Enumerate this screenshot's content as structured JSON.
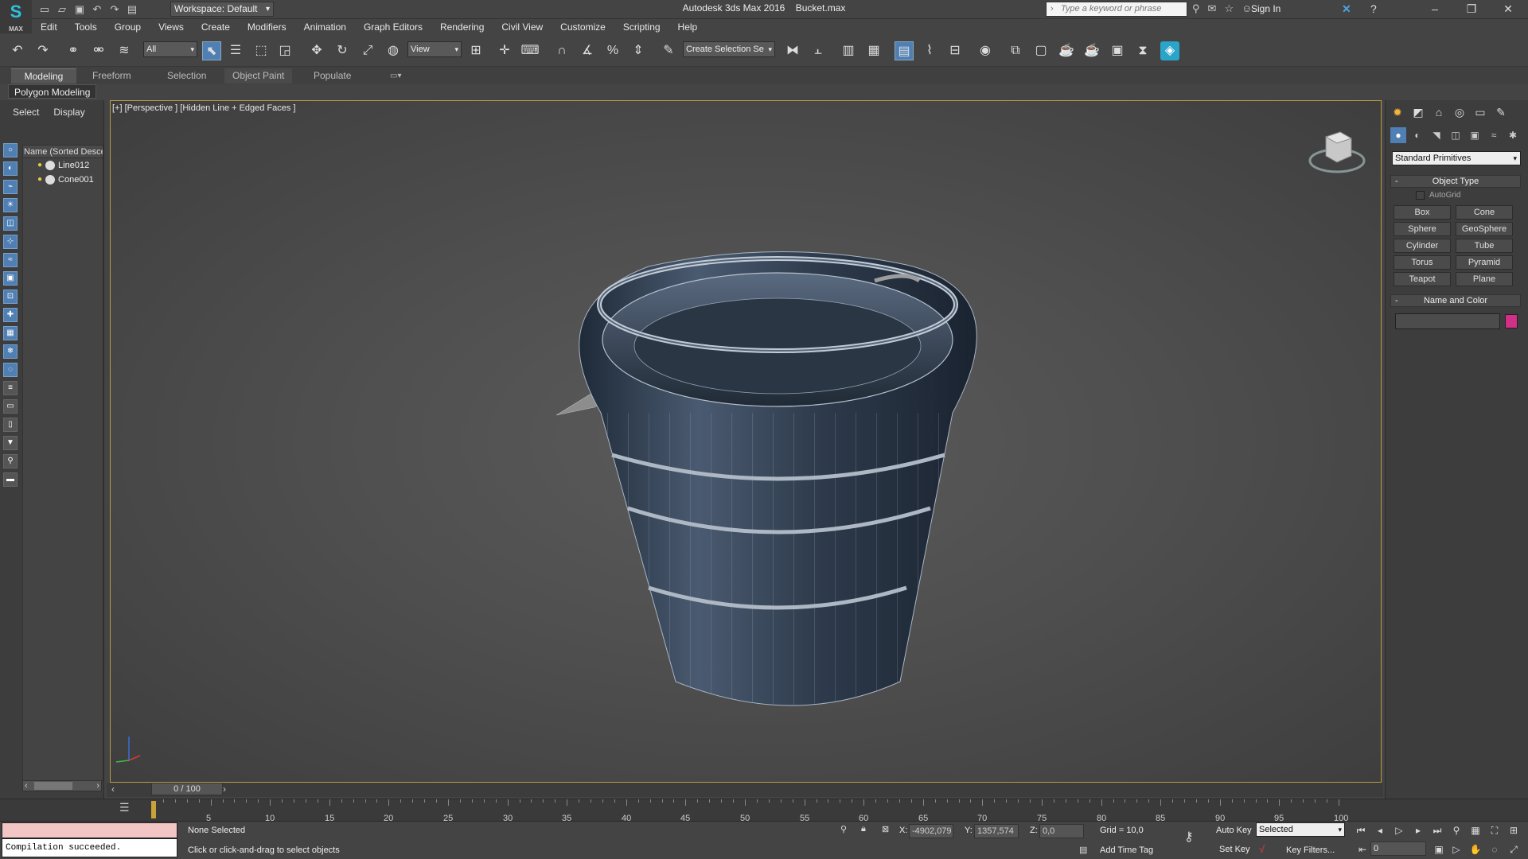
{
  "app": {
    "title": "Autodesk 3ds Max 2016    Bucket.max",
    "logo_text": "MAX",
    "workspace": "Workspace: Default",
    "search_placeholder": "Type a keyword or phrase",
    "sign_in": "Sign In"
  },
  "menu": [
    "Edit",
    "Tools",
    "Group",
    "Views",
    "Create",
    "Modifiers",
    "Animation",
    "Graph Editors",
    "Rendering",
    "Civil View",
    "Customize",
    "Scripting",
    "Help"
  ],
  "toolbar": {
    "selection_filter": "All",
    "ref_coord": "View",
    "named_sel": "Create Selection Se"
  },
  "ribbon": {
    "tabs": [
      "Modeling",
      "Freeform",
      "Selection",
      "Object Paint",
      "Populate"
    ],
    "active_tab": "Modeling",
    "sub": "Polygon Modeling"
  },
  "scene_explorer": {
    "tabs": [
      "Select",
      "Display"
    ],
    "header": "Name (Sorted Descending)",
    "items": [
      "Line012",
      "Cone001"
    ]
  },
  "viewport": {
    "label": "[+] [Perspective ] [Hidden Line + Edged Faces ]"
  },
  "command_panel": {
    "category": "Standard Primitives",
    "object_type_title": "Object Type",
    "autogrid": "AutoGrid",
    "buttons": [
      "Box",
      "Cone",
      "Sphere",
      "GeoSphere",
      "Cylinder",
      "Tube",
      "Torus",
      "Pyramid",
      "Teapot",
      "Plane"
    ],
    "name_color_title": "Name and Color",
    "object_color": "#d22f86"
  },
  "timeline": {
    "slider": "0 / 100",
    "ticks": [
      "5",
      "10",
      "15",
      "20",
      "25",
      "30",
      "35",
      "40",
      "45",
      "50",
      "55",
      "60",
      "65",
      "70",
      "75",
      "80",
      "85",
      "90",
      "95",
      "100"
    ]
  },
  "status": {
    "script_output": "Compilation succeeded.",
    "selection": "None Selected",
    "prompt": "Click or click-and-drag to select objects",
    "x_label": "X:",
    "x": "-4902,079",
    "y_label": "Y:",
    "y": "1357,574",
    "z_label": "Z:",
    "z": "0,0",
    "grid": "Grid = 10,0",
    "add_time_tag": "Add Time Tag",
    "auto_key": "Auto Key",
    "set_key": "Set Key",
    "selected": "Selected",
    "key_filters": "Key Filters...",
    "frame": "0"
  }
}
